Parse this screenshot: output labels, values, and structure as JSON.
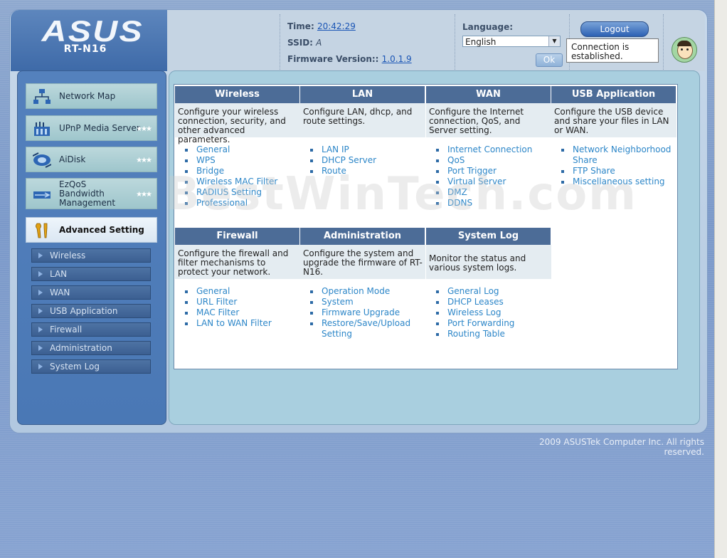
{
  "header": {
    "brand": "ASUS",
    "model": "RT-N16",
    "time_label": "Time:",
    "time_value": "20:42:29",
    "ssid_label": "SSID:",
    "ssid_value": "A",
    "firmware_label": "Firmware Version::",
    "firmware_value": "1.0.1.9",
    "language_label": "Language:",
    "language_value": "English",
    "ok_label": "Ok",
    "logout_label": "Logout",
    "connection_status": "Connection is established."
  },
  "sidebar": {
    "menu": [
      {
        "label": "Network Map",
        "icon": "network-map-icon",
        "stars": false
      },
      {
        "label": "UPnP Media Server",
        "icon": "media-server-icon",
        "stars": true
      },
      {
        "label": "AiDisk",
        "icon": "aidisk-icon",
        "stars": true
      },
      {
        "label": "EzQoS Bandwidth Management",
        "icon": "ezqos-icon",
        "stars": true
      },
      {
        "label": "Advanced Setting",
        "icon": "wrench-icon",
        "stars": false
      }
    ],
    "submenu": [
      "Wireless",
      "LAN",
      "WAN",
      "USB Application",
      "Firewall",
      "Administration",
      "System Log"
    ]
  },
  "sections_top": [
    {
      "title": "Wireless",
      "desc": "Configure your wireless connection, security, and other advanced parameters.",
      "links": [
        "General",
        "WPS",
        "Bridge",
        "Wireless MAC Filter",
        "RADIUS Setting",
        "Professional"
      ]
    },
    {
      "title": "LAN",
      "desc": "Configure LAN, dhcp, and route settings.",
      "links": [
        "LAN IP",
        "DHCP Server",
        "Route"
      ]
    },
    {
      "title": "WAN",
      "desc": "Configure the Internet connection, QoS, and Server setting.",
      "links": [
        "Internet Connection",
        "QoS",
        "Port Trigger",
        "Virtual Server",
        "DMZ",
        "DDNS"
      ]
    },
    {
      "title": "USB Application",
      "desc": "Configure the USB device and share your files in LAN or WAN.",
      "links": [
        "Network Neighborhood Share",
        "FTP Share",
        "Miscellaneous setting"
      ]
    }
  ],
  "sections_bottom": [
    {
      "title": "Firewall",
      "desc": "Configure the firewall and filter mechanisms to protect your network.",
      "links": [
        "General",
        "URL Filter",
        "MAC Filter",
        "LAN to WAN Filter"
      ]
    },
    {
      "title": "Administration",
      "desc": "Configure the system and upgrade the firmware of RT-N16.",
      "links": [
        "Operation Mode",
        "System",
        "Firmware Upgrade",
        "Restore/Save/Upload Setting"
      ]
    },
    {
      "title": "System Log",
      "desc": "Monitor the status and various system logs.",
      "links": [
        "General Log",
        "DHCP Leases",
        "Wireless Log",
        "Port Forwarding",
        "Routing Table"
      ]
    }
  ],
  "watermark": "BestWinTech.com",
  "footer": "2009 ASUSTek Computer Inc. All rights reserved."
}
